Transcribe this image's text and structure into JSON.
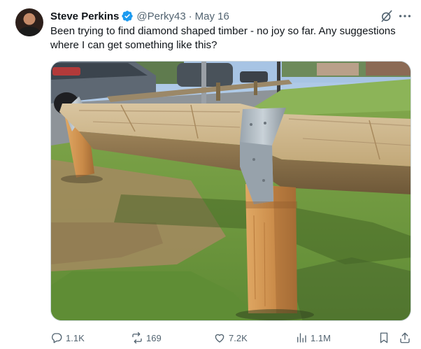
{
  "tweet": {
    "author_name": "Steve Perkins",
    "handle": "@Perky43",
    "separator": "·",
    "date": "May 16",
    "text": "Been trying to find diamond shaped timber - no joy so far. Any suggestions where I can get something like this?"
  },
  "actions": {
    "replies": "1.1K",
    "reposts": "169",
    "likes": "7.2K",
    "views": "1.1M"
  },
  "icons": {
    "verified": "verified-badge-icon",
    "grok": "grok-icon",
    "more": "more-icon",
    "reply": "reply-icon",
    "repost": "repost-icon",
    "like": "heart-icon",
    "views": "views-icon",
    "bookmark": "bookmark-icon",
    "share": "share-icon"
  },
  "colors": {
    "verified_blue": "#1d9bf0",
    "secondary_text": "#536471",
    "primary_text": "#0f1419"
  }
}
